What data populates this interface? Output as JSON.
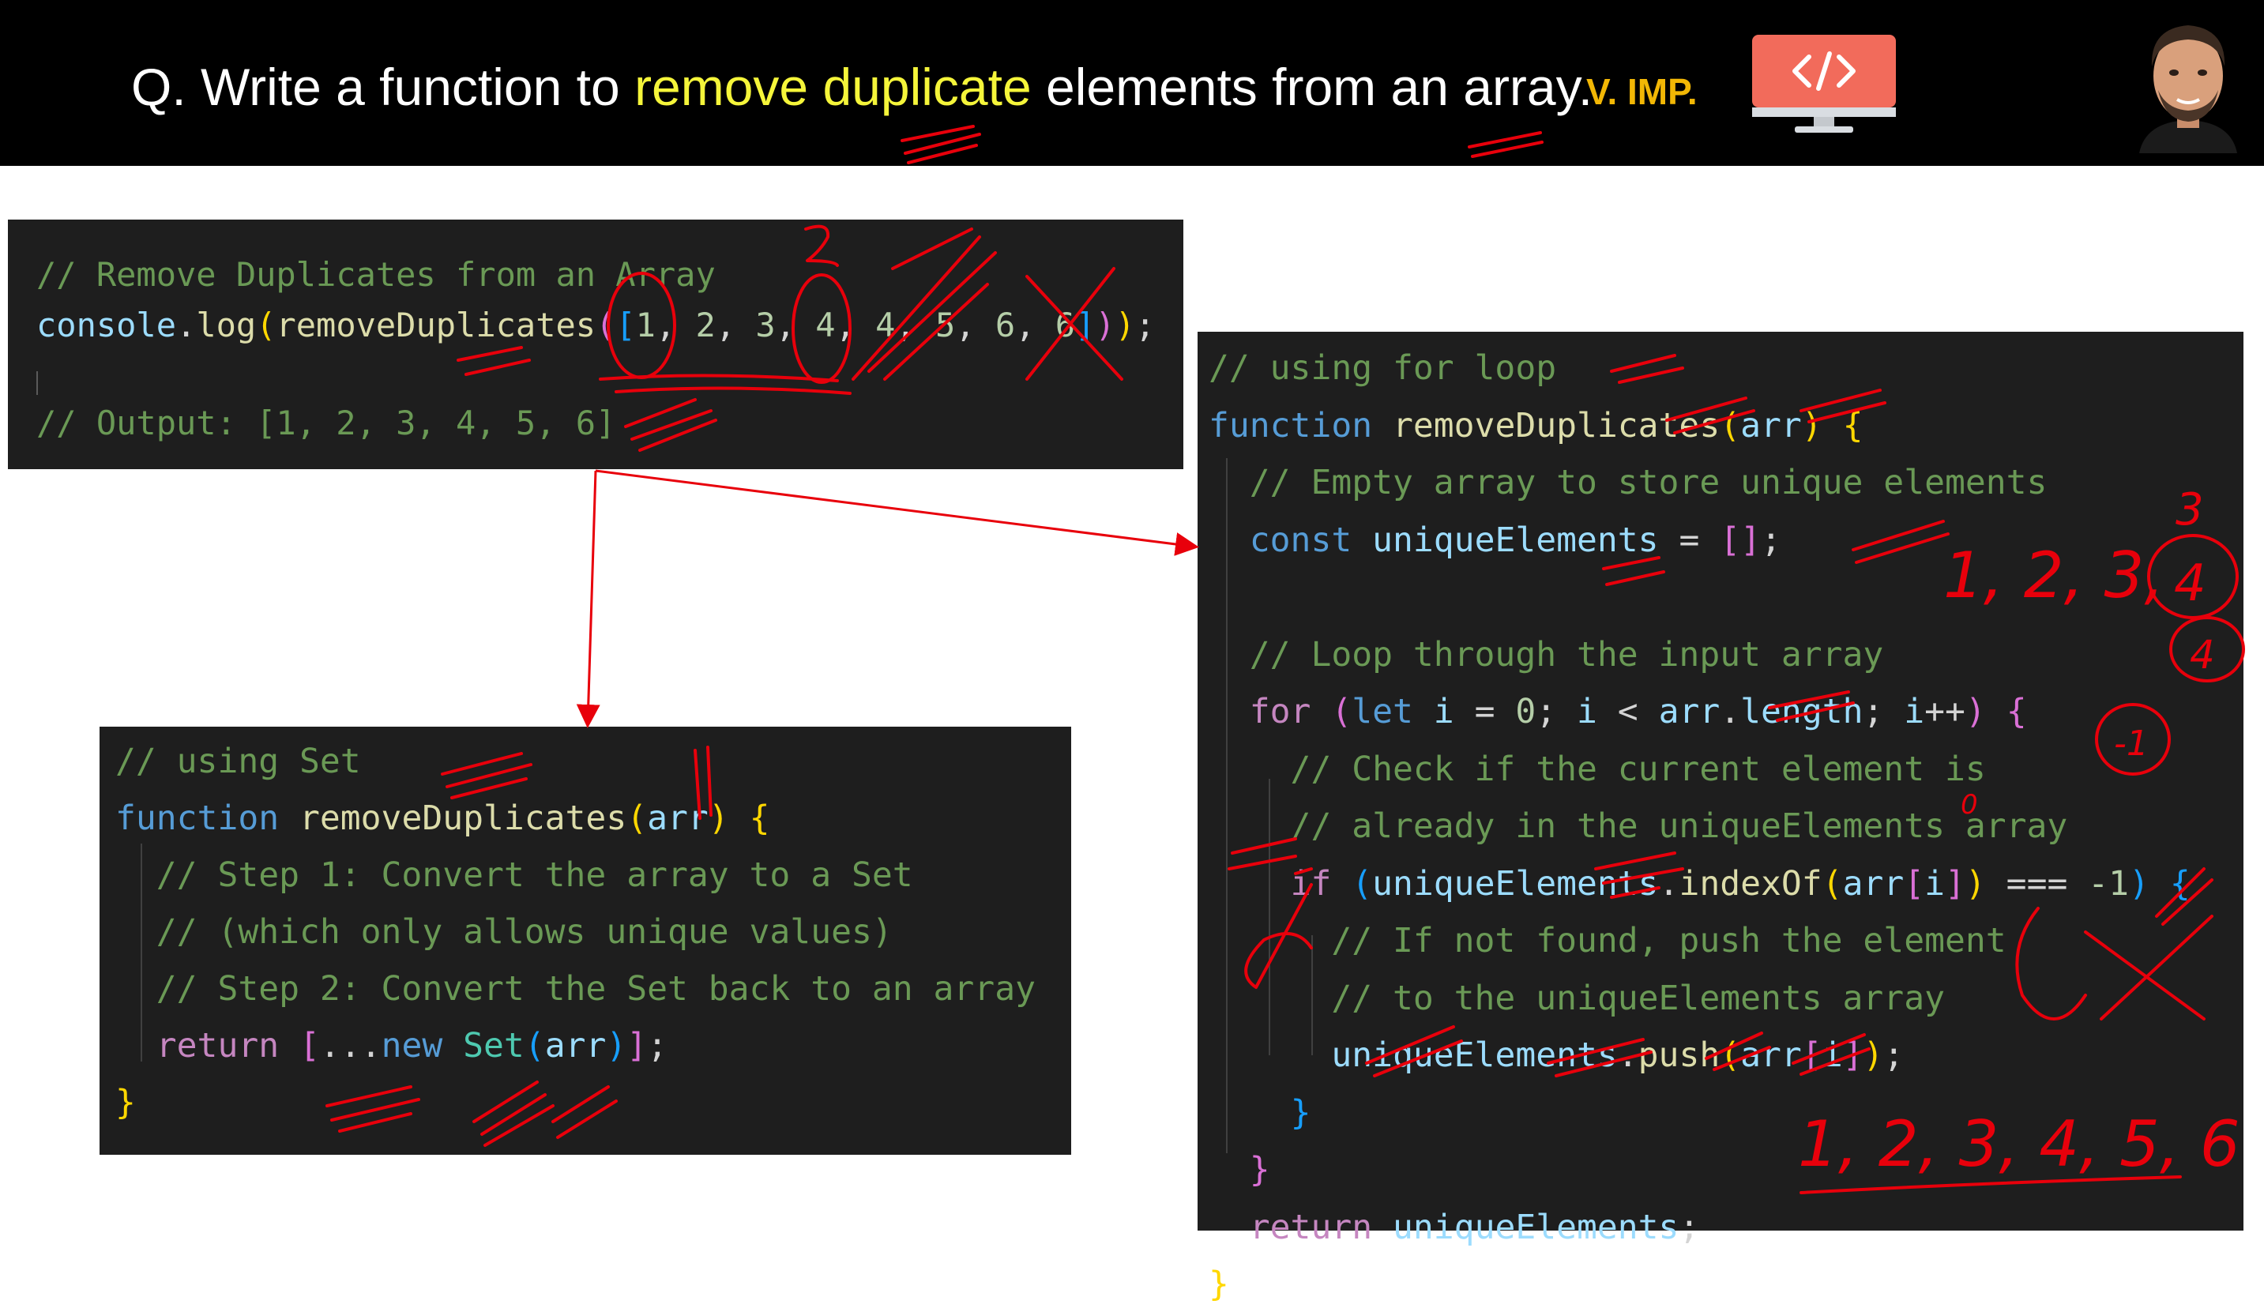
{
  "header": {
    "question_prefix": "Q. Write a function to ",
    "question_highlight": "remove duplicate",
    "question_suffix": " elements from an array.",
    "badge": "V. IMP.",
    "monitor_icon": "code-monitor-icon",
    "avatar": "presenter-avatar"
  },
  "colors": {
    "highlight": "#f5f53a",
    "badge": "#f2b705",
    "annotation": "#e8000b",
    "code_bg": "#1e1e1e",
    "monitor": "#f26b5b"
  },
  "example": {
    "comment": "// Remove Duplicates from an Array",
    "console": "console",
    "dot": ".",
    "log": "log",
    "open_paren": "(",
    "fn": "removeDuplicates",
    "open_paren2": "(",
    "open_bracket": "[",
    "numbers": [
      "1",
      "2",
      "3",
      "4",
      "4",
      "5",
      "6",
      "6"
    ],
    "sep": ", ",
    "close_bracket": "]",
    "close_parens": "));",
    "output_comment": "// Output: [1, 2, 3, 4, 5, 6]"
  },
  "set_solution": {
    "lines": [
      [
        {
          "t": "// using Set",
          "c": "c"
        }
      ],
      [
        {
          "t": "function ",
          "c": "k"
        },
        {
          "t": "removeDuplicates",
          "c": "f"
        },
        {
          "t": "(",
          "c": "br1"
        },
        {
          "t": "arr",
          "c": "v"
        },
        {
          "t": ")",
          "c": "br1"
        },
        {
          "t": " ",
          "c": "p"
        },
        {
          "t": "{",
          "c": "br1"
        }
      ],
      [
        {
          "t": "  // Step 1: Convert the array to a Set",
          "c": "c"
        }
      ],
      [
        {
          "t": "  // (which only allows unique values)",
          "c": "c"
        }
      ],
      [
        {
          "t": "  // Step 2: Convert the Set back to an array",
          "c": "c"
        }
      ],
      [
        {
          "t": "  ",
          "c": "p"
        },
        {
          "t": "return",
          "c": "ctl"
        },
        {
          "t": " ",
          "c": "p"
        },
        {
          "t": "[",
          "c": "br2"
        },
        {
          "t": "...",
          "c": "p"
        },
        {
          "t": "new",
          "c": "k"
        },
        {
          "t": " ",
          "c": "p"
        },
        {
          "t": "Set",
          "c": "t"
        },
        {
          "t": "(",
          "c": "br3"
        },
        {
          "t": "arr",
          "c": "v"
        },
        {
          "t": ")",
          "c": "br3"
        },
        {
          "t": "]",
          "c": "br2"
        },
        {
          "t": ";",
          "c": "p"
        }
      ],
      [
        {
          "t": "}",
          "c": "br1"
        }
      ]
    ]
  },
  "loop_solution": {
    "lines": [
      [
        {
          "t": "// using for loop",
          "c": "c"
        }
      ],
      [
        {
          "t": "function ",
          "c": "k"
        },
        {
          "t": "removeDuplicates",
          "c": "f"
        },
        {
          "t": "(",
          "c": "br1"
        },
        {
          "t": "arr",
          "c": "v"
        },
        {
          "t": ")",
          "c": "br1"
        },
        {
          "t": " ",
          "c": "p"
        },
        {
          "t": "{",
          "c": "br1"
        }
      ],
      [
        {
          "t": "  // Empty array to store unique elements",
          "c": "c"
        }
      ],
      [
        {
          "t": "  ",
          "c": "p"
        },
        {
          "t": "const",
          "c": "k"
        },
        {
          "t": " ",
          "c": "p"
        },
        {
          "t": "uniqueElements",
          "c": "v"
        },
        {
          "t": " = ",
          "c": "p"
        },
        {
          "t": "[]",
          "c": "br2"
        },
        {
          "t": ";",
          "c": "p"
        }
      ],
      [],
      [
        {
          "t": "  // Loop through the input array",
          "c": "c"
        }
      ],
      [
        {
          "t": "  ",
          "c": "p"
        },
        {
          "t": "for",
          "c": "ctl"
        },
        {
          "t": " ",
          "c": "p"
        },
        {
          "t": "(",
          "c": "br2"
        },
        {
          "t": "let",
          "c": "k"
        },
        {
          "t": " ",
          "c": "p"
        },
        {
          "t": "i",
          "c": "v"
        },
        {
          "t": " = ",
          "c": "p"
        },
        {
          "t": "0",
          "c": "n"
        },
        {
          "t": "; ",
          "c": "p"
        },
        {
          "t": "i",
          "c": "v"
        },
        {
          "t": " < ",
          "c": "p"
        },
        {
          "t": "arr",
          "c": "v"
        },
        {
          "t": ".",
          "c": "p"
        },
        {
          "t": "length",
          "c": "v"
        },
        {
          "t": "; ",
          "c": "p"
        },
        {
          "t": "i",
          "c": "v"
        },
        {
          "t": "++",
          "c": "p"
        },
        {
          "t": ")",
          "c": "br2"
        },
        {
          "t": " ",
          "c": "p"
        },
        {
          "t": "{",
          "c": "br2"
        }
      ],
      [
        {
          "t": "    // Check if the current element is",
          "c": "c"
        }
      ],
      [
        {
          "t": "    // already in the uniqueElements array",
          "c": "c"
        }
      ],
      [
        {
          "t": "    ",
          "c": "p"
        },
        {
          "t": "if",
          "c": "ctl"
        },
        {
          "t": " ",
          "c": "p"
        },
        {
          "t": "(",
          "c": "br3"
        },
        {
          "t": "uniqueElements",
          "c": "v"
        },
        {
          "t": ".",
          "c": "p"
        },
        {
          "t": "indexOf",
          "c": "f"
        },
        {
          "t": "(",
          "c": "br1"
        },
        {
          "t": "arr",
          "c": "v"
        },
        {
          "t": "[",
          "c": "br2"
        },
        {
          "t": "i",
          "c": "v"
        },
        {
          "t": "]",
          "c": "br2"
        },
        {
          "t": ")",
          "c": "br1"
        },
        {
          "t": " === ",
          "c": "p"
        },
        {
          "t": "-1",
          "c": "n"
        },
        {
          "t": ")",
          "c": "br3"
        },
        {
          "t": " ",
          "c": "p"
        },
        {
          "t": "{",
          "c": "br3"
        }
      ],
      [
        {
          "t": "      // If not found, push the element",
          "c": "c"
        }
      ],
      [
        {
          "t": "      // to the uniqueElements array",
          "c": "c"
        }
      ],
      [
        {
          "t": "      ",
          "c": "p"
        },
        {
          "t": "uniqueElements",
          "c": "v"
        },
        {
          "t": ".",
          "c": "p"
        },
        {
          "t": "push",
          "c": "f"
        },
        {
          "t": "(",
          "c": "br1"
        },
        {
          "t": "arr",
          "c": "v"
        },
        {
          "t": "[",
          "c": "br2"
        },
        {
          "t": "i",
          "c": "v"
        },
        {
          "t": "]",
          "c": "br2"
        },
        {
          "t": ")",
          "c": "br1"
        },
        {
          "t": ";",
          "c": "p"
        }
      ],
      [
        {
          "t": "    ",
          "c": "p"
        },
        {
          "t": "}",
          "c": "br3"
        }
      ],
      [
        {
          "t": "  ",
          "c": "p"
        },
        {
          "t": "}",
          "c": "br2"
        }
      ],
      [
        {
          "t": "  ",
          "c": "p"
        },
        {
          "t": "return",
          "c": "ctl"
        },
        {
          "t": " ",
          "c": "p"
        },
        {
          "t": "uniqueElements",
          "c": "v"
        },
        {
          "t": ";",
          "c": "p"
        }
      ],
      [
        {
          "t": "}",
          "c": "br1"
        }
      ]
    ]
  },
  "annotations": {
    "digit_2": "2",
    "digit_3": "3",
    "digit_4": "4",
    "minus_one": "-1",
    "zero": "0",
    "seq_partial": "1, 2, 3,",
    "seq_result": "1, 2, 3, 4, 5, 6"
  }
}
